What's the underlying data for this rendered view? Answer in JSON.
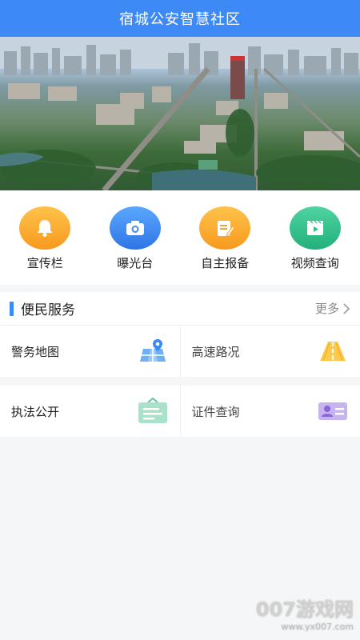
{
  "header": {
    "title": "宿城公安智慧社区"
  },
  "quick_actions": [
    {
      "label": "宣传栏",
      "icon": "bell-icon",
      "color": "#f9a825"
    },
    {
      "label": "曝光台",
      "icon": "camera-icon",
      "color": "#3d8af7"
    },
    {
      "label": "自主报备",
      "icon": "edit-note-icon",
      "color": "#f9a825"
    },
    {
      "label": "视频查询",
      "icon": "video-icon",
      "color": "#2fbf88"
    }
  ],
  "services": {
    "title": "便民服务",
    "more_label": "更多",
    "items": [
      {
        "label": "警务地图",
        "icon": "map-pin-icon"
      },
      {
        "label": "高速路况",
        "icon": "road-icon"
      },
      {
        "label": "执法公开",
        "icon": "notice-board-icon"
      },
      {
        "label": "证件查询",
        "icon": "id-card-icon"
      }
    ]
  },
  "watermark": {
    "main": "007游戏网",
    "url": "www.yx007.com"
  }
}
